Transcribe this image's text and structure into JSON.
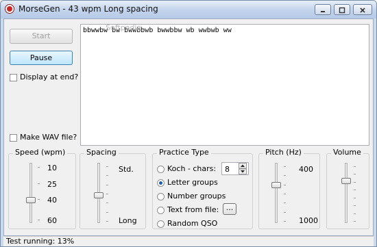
{
  "window": {
    "title": "MorseGen - 43 wpm Long spacing",
    "minimize_icon": "minimize-icon",
    "maximize_icon": "maximize-icon",
    "close_icon": "close-icon"
  },
  "controls": {
    "start_label": "Start",
    "pause_label": "Pause",
    "display_at_end_label": "Display at end?",
    "display_at_end_checked": false,
    "make_wav_label": "Make WAV file?",
    "make_wav_checked": false
  },
  "text_area": {
    "content": "bbwwbw bw bwwbbwb bwwbbw wb wwbwb ww",
    "watermark": "Softpedia"
  },
  "speed": {
    "title": "Speed (wpm)",
    "labels": [
      "10",
      "25",
      "40",
      "60"
    ],
    "value": 43
  },
  "spacing": {
    "title": "Spacing",
    "labels": [
      "Std.",
      "Long"
    ],
    "level": 0.55
  },
  "practice": {
    "title": "Practice Type",
    "options": [
      {
        "label": "Koch - chars:",
        "selected": false
      },
      {
        "label": "Letter groups",
        "selected": true
      },
      {
        "label": "Number groups",
        "selected": false
      },
      {
        "label": "Text from file:",
        "selected": false
      },
      {
        "label": "Random QSO",
        "selected": false
      }
    ],
    "koch_chars": "8",
    "browse_label": "..."
  },
  "pitch": {
    "title": "Pitch (Hz)",
    "labels": [
      "400",
      "1000"
    ],
    "level": 0.35
  },
  "volume": {
    "title": "Volume",
    "level": 0.28
  },
  "status": {
    "text": "Test running: 13%"
  }
}
